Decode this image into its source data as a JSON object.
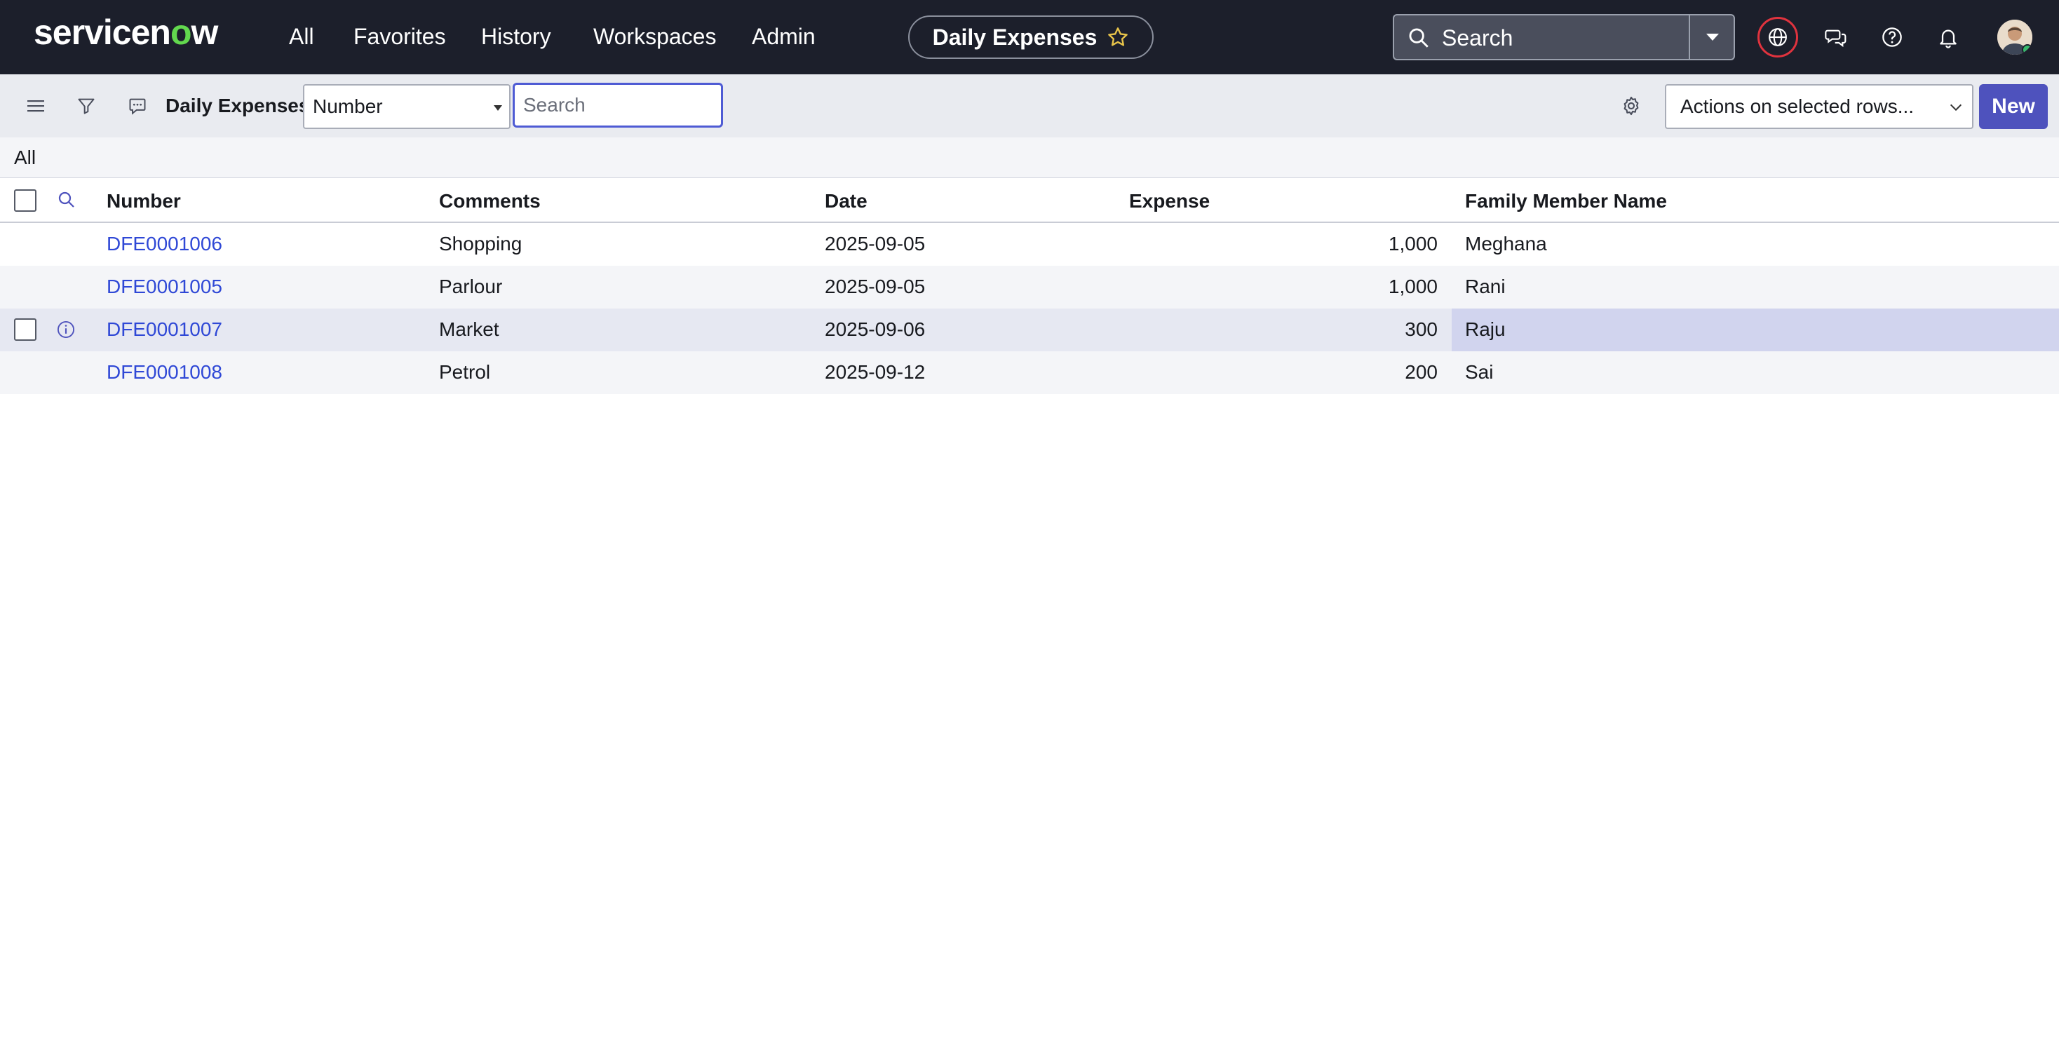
{
  "topbar": {
    "logo_text_before": "servicen",
    "logo_o": "o",
    "logo_text_after": "w",
    "nav": [
      "All",
      "Favorites",
      "History",
      "Workspaces",
      "Admin"
    ],
    "context_title": "Daily Expenses",
    "search_placeholder": "Search",
    "icons": [
      "globe-icon",
      "chat-icon",
      "help-icon",
      "bell-icon"
    ]
  },
  "toolbar": {
    "list_title": "Daily Expenses",
    "field_value": "Number",
    "search_placeholder": "Search",
    "actions_value": "Actions on selected rows...",
    "new_label": "New"
  },
  "breadcrumb": {
    "label": "All"
  },
  "table": {
    "columns": [
      "Number",
      "Comments",
      "Date",
      "Expense",
      "Family Member Name"
    ],
    "rows": [
      {
        "number": "DFE0001006",
        "comments": "Shopping",
        "date": "2025-09-05",
        "expense": "1,000",
        "family_member": "Meghana"
      },
      {
        "number": "DFE0001005",
        "comments": "Parlour",
        "date": "2025-09-05",
        "expense": "1,000",
        "family_member": "Rani"
      },
      {
        "number": "DFE0001007",
        "comments": "Market",
        "date": "2025-09-06",
        "expense": "300",
        "family_member": "Raju"
      },
      {
        "number": "DFE0001008",
        "comments": "Petrol",
        "date": "2025-09-12",
        "expense": "200",
        "family_member": "Sai"
      }
    ]
  },
  "colors": {
    "topbar": "#1c1f2b",
    "accent": "#4e52bd",
    "link": "#2f48d6",
    "logo_green": "#62d84e",
    "alert_ring": "#e0333e"
  }
}
